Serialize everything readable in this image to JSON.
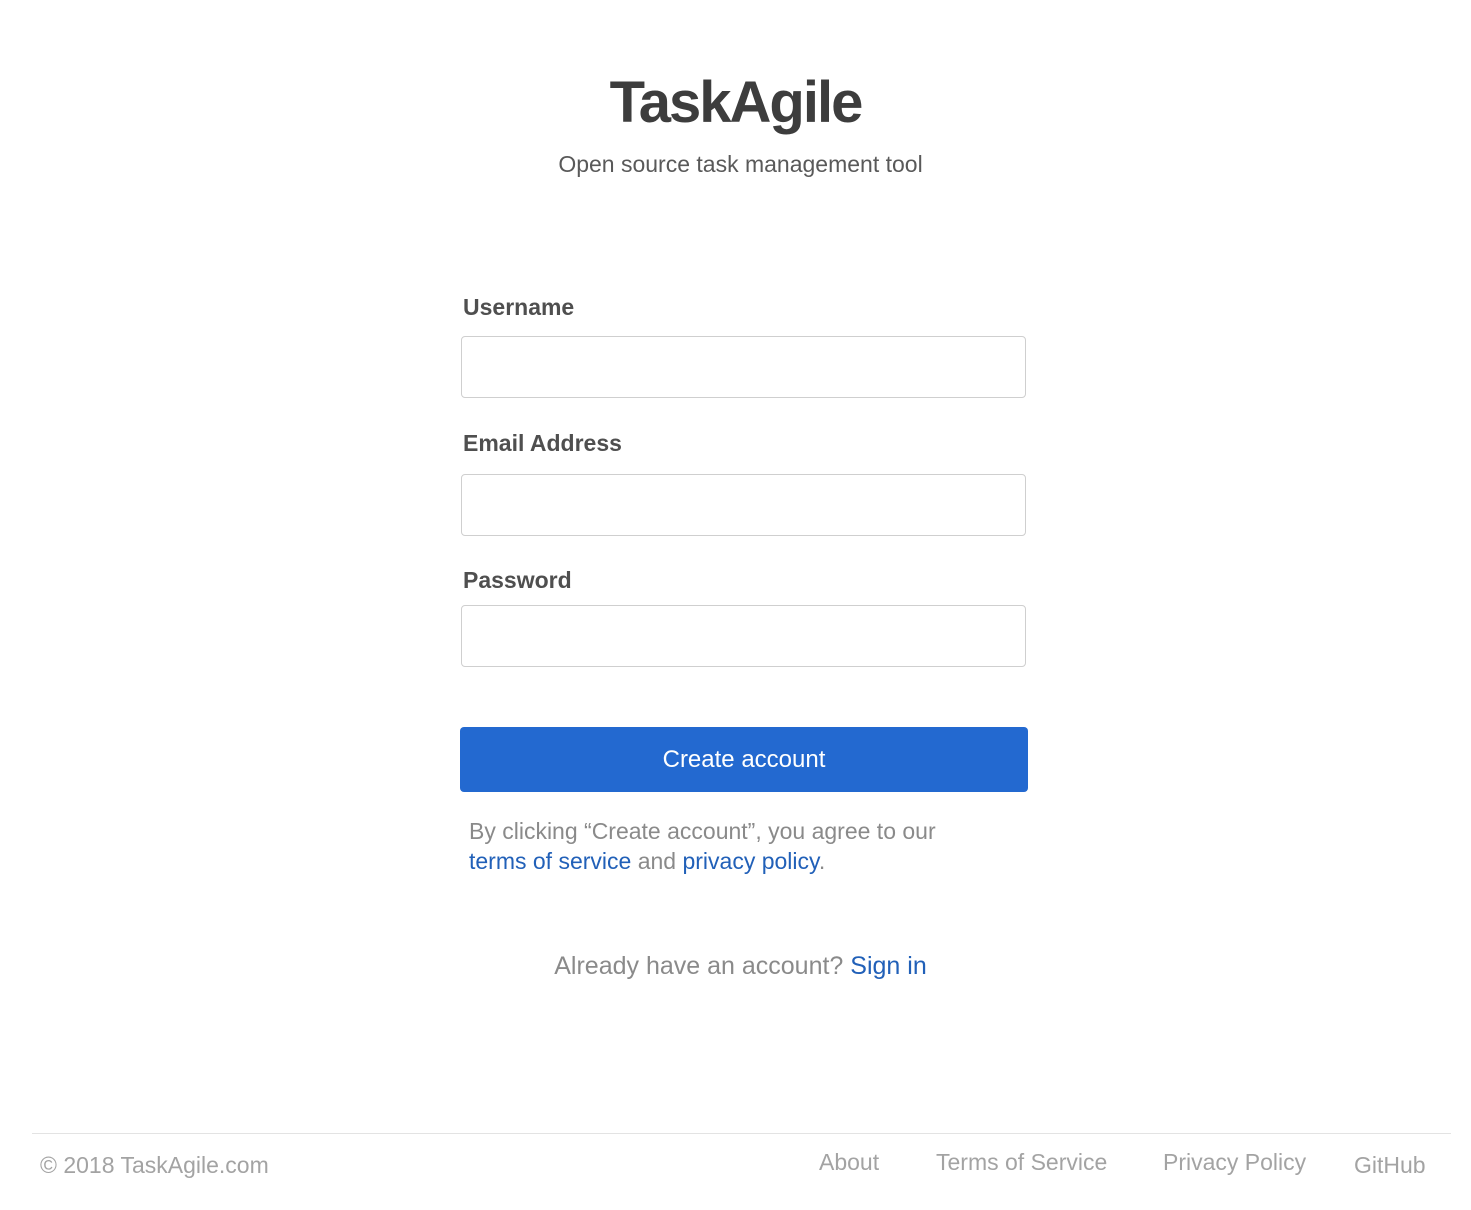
{
  "header": {
    "logo": "TaskAgile",
    "tagline": "Open source task management tool"
  },
  "form": {
    "username_label": "Username",
    "username_value": "",
    "email_label": "Email Address",
    "email_value": "",
    "password_label": "Password",
    "password_value": "",
    "submit_label": "Create account",
    "legal_prefix": "By clicking “Create account”, you agree to our",
    "terms_link": "terms of service",
    "legal_and": "and",
    "privacy_link": "privacy policy",
    "legal_suffix": "."
  },
  "signin": {
    "prompt": "Already have an account?",
    "link": "Sign in"
  },
  "footer": {
    "copyright": "© 2018 TaskAgile.com",
    "links": [
      "About",
      "Terms of Service",
      "Privacy Policy",
      "GitHub"
    ]
  },
  "colors": {
    "primary": "#2369d0",
    "link": "#2160b8",
    "heading": "#3d3d3d",
    "muted": "#8a8a8a"
  }
}
